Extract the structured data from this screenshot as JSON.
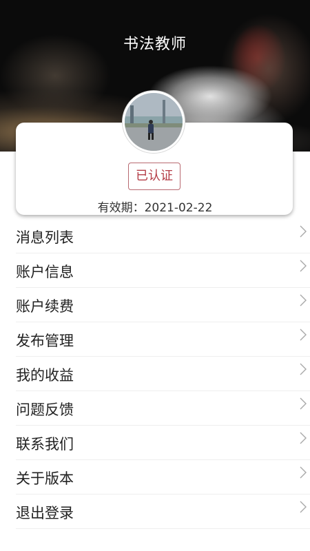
{
  "header": {
    "title": "书法教师"
  },
  "profile": {
    "avatar_alt": "user-avatar",
    "badge_label": "已认证",
    "validity_label": "有效期：",
    "validity_date": "2021-02-22",
    "badge_color": "#b33a44"
  },
  "menu": {
    "items": [
      {
        "label": "消息列表",
        "icon": "chevron-right-icon"
      },
      {
        "label": "账户信息",
        "icon": "chevron-right-icon"
      },
      {
        "label": "账户续费",
        "icon": "chevron-right-icon"
      },
      {
        "label": "发布管理",
        "icon": "chevron-right-icon"
      },
      {
        "label": "我的收益",
        "icon": "chevron-right-icon"
      },
      {
        "label": "问题反馈",
        "icon": "chevron-right-icon"
      },
      {
        "label": "联系我们",
        "icon": "chevron-right-icon"
      },
      {
        "label": "关于版本",
        "icon": "chevron-right-icon"
      },
      {
        "label": "退出登录",
        "icon": "chevron-right-icon"
      }
    ]
  }
}
